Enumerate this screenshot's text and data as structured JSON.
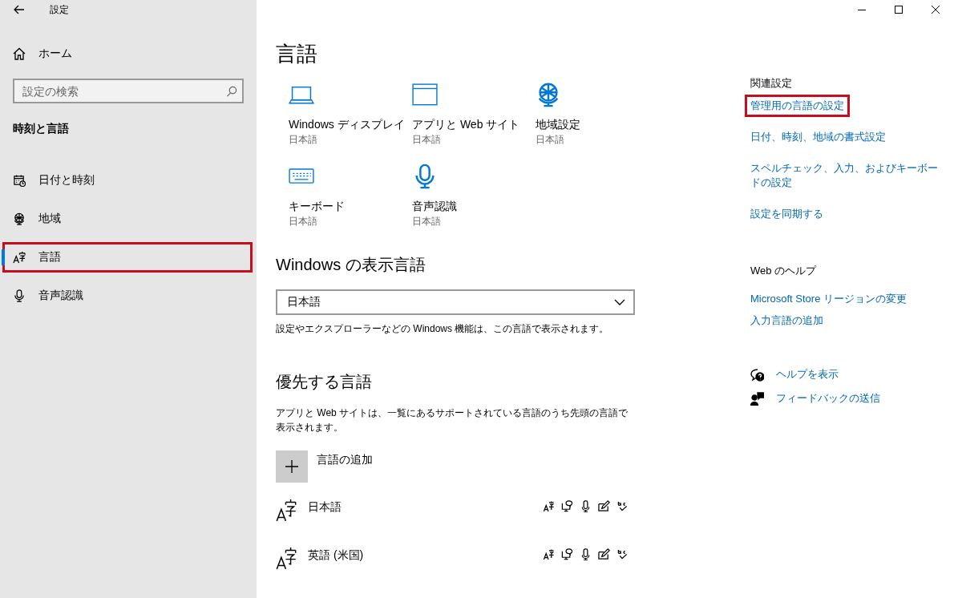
{
  "window": {
    "title": "設定"
  },
  "sidebar": {
    "home": "ホーム",
    "search": {
      "placeholder": "設定の検索"
    },
    "section": "時刻と言語",
    "items": [
      {
        "label": "日付と時刻",
        "selected": false,
        "highlighted": false
      },
      {
        "label": "地域",
        "selected": false,
        "highlighted": false
      },
      {
        "label": "言語",
        "selected": true,
        "highlighted": true
      },
      {
        "label": "音声認識",
        "selected": false,
        "highlighted": false
      }
    ]
  },
  "page": {
    "title": "言語",
    "tiles": [
      {
        "label": "Windows ディスプレイ",
        "value": "日本語"
      },
      {
        "label": "アプリと Web サイト",
        "value": "日本語"
      },
      {
        "label": "地域設定",
        "value": "日本語"
      },
      {
        "label": "キーボード",
        "value": "日本語"
      },
      {
        "label": "音声認識",
        "value": "日本語"
      }
    ],
    "display_language": {
      "heading": "Windows の表示言語",
      "dropdown": {
        "value": "日本語"
      },
      "description": "設定やエクスプローラーなどの Windows 機能は、この言語で表示されます。"
    },
    "preferred_languages": {
      "heading": "優先する言語",
      "description": "アプリと Web サイトは、一覧にあるサポートされている言語のうち先頭の言語で表示されます。",
      "add_button": "言語の追加",
      "languages": [
        {
          "name": "日本語"
        },
        {
          "name": "英語 (米国)"
        }
      ]
    }
  },
  "related_settings": {
    "heading": "関連設定",
    "links": [
      {
        "label": "管理用の言語の設定",
        "highlighted": true
      },
      {
        "label": "日付、時刻、地域の書式設定",
        "highlighted": false
      },
      {
        "label": "スペルチェック、入力、およびキーボードの設定",
        "highlighted": false
      },
      {
        "label": "設定を同期する",
        "highlighted": false
      }
    ]
  },
  "web_help": {
    "heading": "Web のヘルプ",
    "links": [
      {
        "label": "Microsoft Store リージョンの変更"
      },
      {
        "label": "入力言語の追加"
      }
    ]
  },
  "support": [
    {
      "label": "ヘルプを表示"
    },
    {
      "label": "フィードバックの送信"
    }
  ]
}
